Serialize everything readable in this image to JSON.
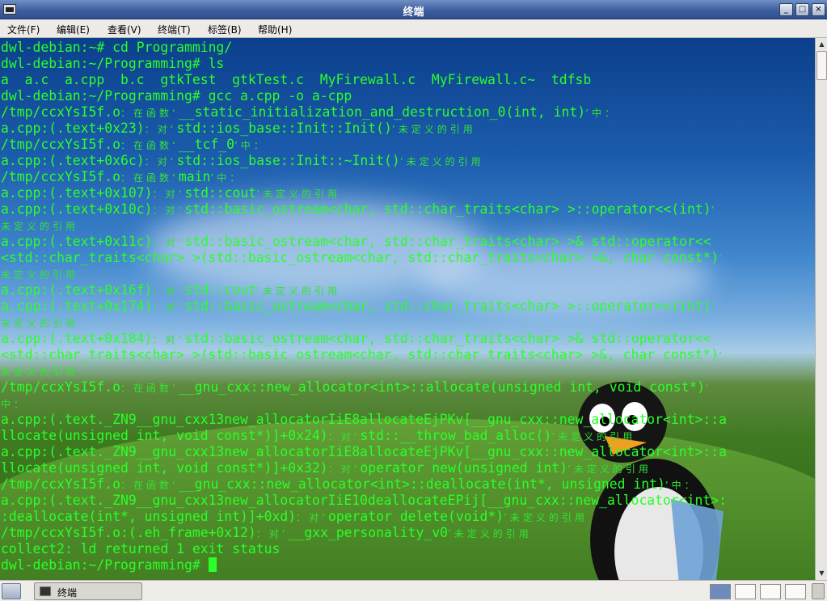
{
  "window": {
    "title": "终端",
    "buttons": {
      "minimize": "_",
      "maximize": "□",
      "close": "×"
    }
  },
  "menubar": {
    "items": [
      "文件(F)",
      "编辑(E)",
      "查看(V)",
      "终端(T)",
      "标签(B)",
      "帮助(H)"
    ]
  },
  "terminal": {
    "lines": [
      [
        [
          "t",
          "dwl-debian:~# cd Programming/"
        ]
      ],
      [
        [
          "t",
          "dwl-debian:~/Programming# ls"
        ]
      ],
      [
        [
          "t",
          "a  a.c  a.cpp  b.c  gtkTest  gtkTest.c  MyFirewall.c  MyFirewall.c~  tdfsb"
        ]
      ],
      [
        [
          "t",
          "dwl-debian:~/Programming# gcc a.cpp -o a-cpp"
        ]
      ],
      [
        [
          "t",
          "/tmp/ccxYsI5f.o"
        ],
        [
          "z",
          "：在函数‘"
        ],
        [
          "t",
          "__static_initialization_and_destruction_0(int, int)"
        ],
        [
          "z",
          "’中："
        ]
      ],
      [
        [
          "t",
          "a.cpp:(.text+0x23)"
        ],
        [
          "z",
          "：对‘"
        ],
        [
          "t",
          "std::ios_base::Init::Init()"
        ],
        [
          "z",
          "’未定义的引用"
        ]
      ],
      [
        [
          "t",
          "/tmp/ccxYsI5f.o"
        ],
        [
          "z",
          "：在函数‘"
        ],
        [
          "t",
          "__tcf_0"
        ],
        [
          "z",
          "’中："
        ]
      ],
      [
        [
          "t",
          "a.cpp:(.text+0x6c)"
        ],
        [
          "z",
          "：对‘"
        ],
        [
          "t",
          "std::ios_base::Init::~Init()"
        ],
        [
          "z",
          "’未定义的引用"
        ]
      ],
      [
        [
          "t",
          "/tmp/ccxYsI5f.o"
        ],
        [
          "z",
          "：在函数‘"
        ],
        [
          "t",
          "main"
        ],
        [
          "z",
          "’中："
        ]
      ],
      [
        [
          "t",
          "a.cpp:(.text+0x107)"
        ],
        [
          "z",
          "：对‘"
        ],
        [
          "t",
          "std::cout"
        ],
        [
          "z",
          "’未定义的引用"
        ]
      ],
      [
        [
          "t",
          "a.cpp:(.text+0x10c)"
        ],
        [
          "z",
          "：对‘"
        ],
        [
          "t",
          "std::basic_ostream<char, std::char_traits<char> >::operator<<(int)"
        ],
        [
          "z",
          "’"
        ]
      ],
      [
        [
          "z",
          "未定义的引用"
        ]
      ],
      [
        [
          "t",
          "a.cpp:(.text+0x11c)"
        ],
        [
          "z",
          "：对‘"
        ],
        [
          "t",
          "std::basic_ostream<char, std::char_traits<char> >& std::operator<<"
        ]
      ],
      [
        [
          "t",
          "<std::char_traits<char> >(std::basic_ostream<char, std::char_traits<char> >&, char const*)"
        ],
        [
          "z",
          "’"
        ]
      ],
      [
        [
          "z",
          "未定义的引用"
        ]
      ],
      [
        [
          "t",
          "a.cpp:(.text+0x16f)"
        ],
        [
          "z",
          "：对‘"
        ],
        [
          "t",
          "std::cout"
        ],
        [
          "z",
          "’未定义的引用"
        ]
      ],
      [
        [
          "t",
          "a.cpp:(.text+0x174)"
        ],
        [
          "z",
          "：对‘"
        ],
        [
          "t",
          "std::basic_ostream<char, std::char_traits<char> >::operator<<(int)"
        ],
        [
          "z",
          "’"
        ]
      ],
      [
        [
          "z",
          "未定义的引用"
        ]
      ],
      [
        [
          "t",
          "a.cpp:(.text+0x184)"
        ],
        [
          "z",
          "：对‘"
        ],
        [
          "t",
          "std::basic_ostream<char, std::char_traits<char> >& std::operator<<"
        ]
      ],
      [
        [
          "t",
          "<std::char_traits<char> >(std::basic_ostream<char, std::char_traits<char> >&, char const*)"
        ],
        [
          "z",
          "’"
        ]
      ],
      [
        [
          "z",
          "未定义的引用"
        ]
      ],
      [
        [
          "t",
          "/tmp/ccxYsI5f.o"
        ],
        [
          "z",
          "：在函数‘"
        ],
        [
          "t",
          "__gnu_cxx::new_allocator<int>::allocate(unsigned int, void const*)"
        ],
        [
          "z",
          "’"
        ]
      ],
      [
        [
          "z",
          "中："
        ]
      ],
      [
        [
          "t",
          "a.cpp:(.text._ZN9__gnu_cxx13new_allocatorIiE8allocateEjPKv[__gnu_cxx::new_allocator<int>::a"
        ]
      ],
      [
        [
          "t",
          "llocate(unsigned int, void const*)]+0x24)"
        ],
        [
          "z",
          "：对‘"
        ],
        [
          "t",
          "std::__throw_bad_alloc()"
        ],
        [
          "z",
          "’未定义的引用"
        ]
      ],
      [
        [
          "t",
          "a.cpp:(.text._ZN9__gnu_cxx13new_allocatorIiE8allocateEjPKv[__gnu_cxx::new_allocator<int>::a"
        ]
      ],
      [
        [
          "t",
          "llocate(unsigned int, void const*)]+0x32)"
        ],
        [
          "z",
          "：对‘"
        ],
        [
          "t",
          "operator new(unsigned int)"
        ],
        [
          "z",
          "’未定义的引用"
        ]
      ],
      [
        [
          "t",
          "/tmp/ccxYsI5f.o"
        ],
        [
          "z",
          "：在函数‘"
        ],
        [
          "t",
          "__gnu_cxx::new_allocator<int>::deallocate(int*, unsigned int)"
        ],
        [
          "z",
          "’中："
        ]
      ],
      [
        [
          "t",
          "a.cpp:(.text._ZN9__gnu_cxx13new_allocatorIiE10deallocateEPij[__gnu_cxx::new_allocator<int>:"
        ]
      ],
      [
        [
          "t",
          ":deallocate(int*, unsigned int)]+0xd)"
        ],
        [
          "z",
          "：对‘"
        ],
        [
          "t",
          "operator delete(void*)"
        ],
        [
          "z",
          "’未定义的引用"
        ]
      ],
      [
        [
          "t",
          "/tmp/ccxYsI5f.o:(.eh_frame+0x12)"
        ],
        [
          "z",
          "：对‘"
        ],
        [
          "t",
          "__gxx_personality_v0"
        ],
        [
          "z",
          "’未定义的引用"
        ]
      ],
      [
        [
          "t",
          "collect2: ld returned 1 exit status"
        ]
      ],
      [
        [
          "t",
          "dwl-debian:~/Programming# "
        ]
      ]
    ]
  },
  "taskbar": {
    "task_label": "终端"
  },
  "colors": {
    "terminal_text": "#2aff2a",
    "titlebar": "#3e5f9e"
  }
}
